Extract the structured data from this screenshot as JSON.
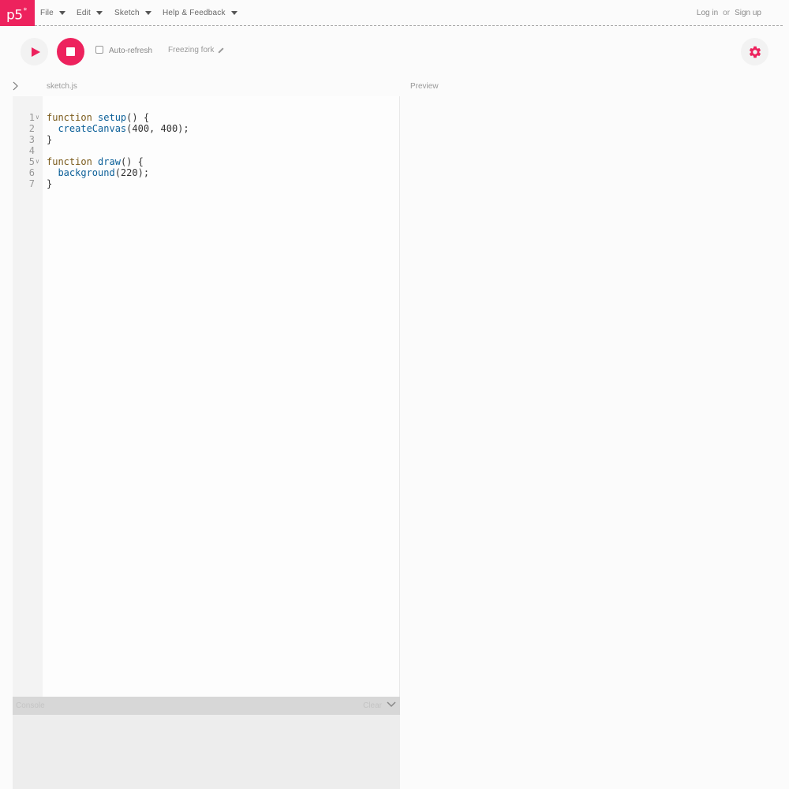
{
  "logo": {
    "text": "p5",
    "mark": "*"
  },
  "menu": [
    {
      "label": "File"
    },
    {
      "label": "Edit"
    },
    {
      "label": "Sketch"
    },
    {
      "label": "Help & Feedback"
    }
  ],
  "auth": {
    "login": "Log in",
    "or": "or",
    "signup": "Sign up"
  },
  "toolbar": {
    "play_icon": "play-icon",
    "stop_icon": "stop-icon",
    "auto_refresh_label": "Auto-refresh",
    "auto_refresh_checked": false,
    "sketch_name": "Freezing fork",
    "settings_icon": "gear-icon"
  },
  "editor": {
    "tab_label": "sketch.js",
    "lines": [
      {
        "n": "1",
        "fold": true,
        "tokens": [
          {
            "t": "function ",
            "c": "kw"
          },
          {
            "t": "setup",
            "c": "fn"
          },
          {
            "t": "() {",
            "c": ""
          }
        ]
      },
      {
        "n": "2",
        "fold": false,
        "tokens": [
          {
            "t": "  ",
            "c": ""
          },
          {
            "t": "createCanvas",
            "c": "fn"
          },
          {
            "t": "(400, 400);",
            "c": ""
          }
        ]
      },
      {
        "n": "3",
        "fold": false,
        "tokens": [
          {
            "t": "}",
            "c": ""
          }
        ]
      },
      {
        "n": "4",
        "fold": false,
        "tokens": []
      },
      {
        "n": "5",
        "fold": true,
        "tokens": [
          {
            "t": "function ",
            "c": "kw"
          },
          {
            "t": "draw",
            "c": "fn"
          },
          {
            "t": "() {",
            "c": ""
          }
        ]
      },
      {
        "n": "6",
        "fold": false,
        "tokens": [
          {
            "t": "  ",
            "c": ""
          },
          {
            "t": "background",
            "c": "fn"
          },
          {
            "t": "(220);",
            "c": ""
          }
        ]
      },
      {
        "n": "7",
        "fold": false,
        "tokens": [
          {
            "t": "}",
            "c": ""
          }
        ]
      }
    ]
  },
  "preview": {
    "label": "Preview"
  },
  "console": {
    "title": "Console",
    "clear_label": "Clear"
  },
  "colors": {
    "accent": "#ed225d",
    "keyword": "#7a5a1a",
    "function": "#0b5f98"
  }
}
